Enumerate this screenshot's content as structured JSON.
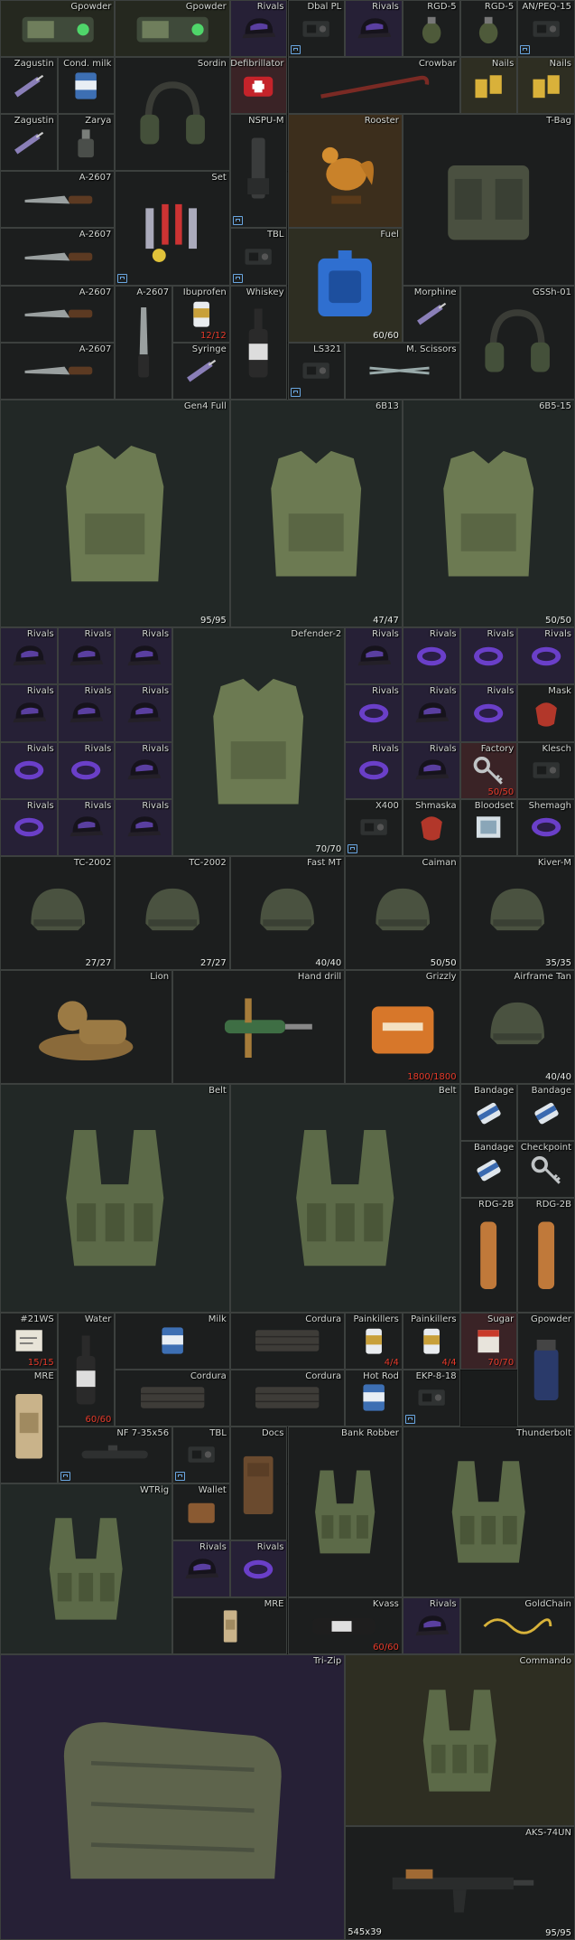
{
  "stash": {
    "footer_size": "545x39",
    "items": [
      {
        "name": "Gpowder",
        "art": "gpowder",
        "bg": "b-t",
        "c": 0,
        "r": 0,
        "w": 2,
        "h": 1
      },
      {
        "name": "Gpowder",
        "art": "gpowder",
        "bg": "b-t",
        "c": 2,
        "r": 0,
        "w": 2,
        "h": 1
      },
      {
        "name": "Rivals",
        "art": "cap",
        "bg": "b-v",
        "c": 4,
        "r": 0,
        "w": 1,
        "h": 1
      },
      {
        "name": "Dbal PL",
        "art": "device",
        "bg": "b-k",
        "c": 5,
        "r": 0,
        "w": 1,
        "h": 1,
        "tag": true
      },
      {
        "name": "Rivals",
        "art": "cap",
        "bg": "b-v",
        "c": 6,
        "r": 0,
        "w": 1,
        "h": 1
      },
      {
        "name": "RGD-5",
        "art": "grenade",
        "bg": "b-k",
        "c": 7,
        "r": 0,
        "w": 1,
        "h": 1
      },
      {
        "name": "RGD-5",
        "art": "grenade",
        "bg": "b-k",
        "c": 8,
        "r": 0,
        "w": 1,
        "h": 1
      },
      {
        "name": "AN/PEQ-15",
        "art": "device",
        "bg": "b-k",
        "c": 9,
        "r": 0,
        "w": 1,
        "h": 1,
        "tag": true
      },
      {
        "name": "Zagustin",
        "art": "syringe",
        "bg": "b-k",
        "c": 0,
        "r": 1,
        "w": 1,
        "h": 1
      },
      {
        "name": "Cond. milk",
        "art": "can",
        "bg": "b-k",
        "c": 1,
        "r": 1,
        "w": 1,
        "h": 1
      },
      {
        "name": "Sordin",
        "art": "headset",
        "bg": "b-k",
        "c": 2,
        "r": 1,
        "w": 2,
        "h": 2
      },
      {
        "name": "Defibrillator",
        "art": "defib",
        "bg": "b-r",
        "c": 4,
        "r": 1,
        "w": 1,
        "h": 1
      },
      {
        "name": "Crowbar",
        "art": "crowbar",
        "bg": "b-k",
        "c": 5,
        "r": 1,
        "w": 3,
        "h": 1
      },
      {
        "name": "Nails",
        "art": "nails",
        "bg": "b-y",
        "c": 8,
        "r": 1,
        "w": 1,
        "h": 1
      },
      {
        "name": "Nails",
        "art": "nails",
        "bg": "b-y",
        "c": 9,
        "r": 1,
        "w": 1,
        "h": 1
      },
      {
        "name": "Zagustin",
        "art": "syringe",
        "bg": "b-k",
        "c": 0,
        "r": 2,
        "w": 1,
        "h": 1
      },
      {
        "name": "Zarya",
        "art": "flashbang",
        "bg": "b-k",
        "c": 1,
        "r": 2,
        "w": 1,
        "h": 1
      },
      {
        "name": "NSPU-M",
        "art": "scope",
        "bg": "b-k",
        "c": 4,
        "r": 2,
        "w": 1,
        "h": 2,
        "tag": true
      },
      {
        "name": "Rooster",
        "art": "rooster",
        "bg": "b-o",
        "c": 5,
        "r": 2,
        "w": 2,
        "h": 2
      },
      {
        "name": "T-Bag",
        "art": "pouch",
        "bg": "b-k",
        "c": 7,
        "r": 2,
        "w": 3,
        "h": 3
      },
      {
        "name": "A-2607",
        "art": "knife",
        "bg": "b-k",
        "c": 0,
        "r": 3,
        "w": 2,
        "h": 1
      },
      {
        "name": "Set",
        "art": "toolset",
        "bg": "b-k",
        "c": 2,
        "r": 3,
        "w": 2,
        "h": 2,
        "tag": true
      },
      {
        "name": "A-2607",
        "art": "knife",
        "bg": "b-k",
        "c": 0,
        "r": 4,
        "w": 2,
        "h": 1
      },
      {
        "name": "TBL",
        "art": "device",
        "bg": "b-k",
        "c": 4,
        "r": 4,
        "w": 1,
        "h": 1,
        "tag": true
      },
      {
        "name": "Fuel",
        "art": "fuel",
        "bg": "b-y",
        "c": 5,
        "r": 4,
        "w": 2,
        "h": 2,
        "cnt": "60/60"
      },
      {
        "name": "A-2607",
        "art": "knife",
        "bg": "b-k",
        "c": 0,
        "r": 5,
        "w": 2,
        "h": 1
      },
      {
        "name": "A-2607",
        "art": "knife-v",
        "bg": "b-k",
        "c": 2,
        "r": 5,
        "w": 1,
        "h": 2
      },
      {
        "name": "Ibuprofen",
        "art": "pills",
        "bg": "b-k",
        "c": 3,
        "r": 5,
        "w": 1,
        "h": 1,
        "cnt": "12/12",
        "red": true
      },
      {
        "name": "Whiskey",
        "art": "bottle",
        "bg": "b-k",
        "c": 4,
        "r": 5,
        "w": 1,
        "h": 2
      },
      {
        "name": "Morphine",
        "art": "syringe",
        "bg": "b-k",
        "c": 7,
        "r": 5,
        "w": 1,
        "h": 1
      },
      {
        "name": "GSSh-01",
        "art": "headset",
        "bg": "b-k",
        "c": 8,
        "r": 5,
        "w": 2,
        "h": 2
      },
      {
        "name": "A-2607",
        "art": "knife",
        "bg": "b-k",
        "c": 0,
        "r": 6,
        "w": 2,
        "h": 1
      },
      {
        "name": "Syringe",
        "art": "syringe",
        "bg": "b-k",
        "c": 3,
        "r": 6,
        "w": 1,
        "h": 1
      },
      {
        "name": "LS321",
        "art": "device",
        "bg": "b-k",
        "c": 5,
        "r": 6,
        "w": 1,
        "h": 1,
        "tag": true
      },
      {
        "name": "M. Scissors",
        "art": "scissors",
        "bg": "b-k",
        "c": 6,
        "r": 6,
        "w": 2,
        "h": 1
      },
      {
        "name": "Gen4 Full",
        "art": "armor",
        "bg": "b-g",
        "c": 0,
        "r": 7,
        "w": 4,
        "h": 4,
        "cnt": "95/95"
      },
      {
        "name": "6B13",
        "art": "armor",
        "bg": "b-g",
        "c": 4,
        "r": 7,
        "w": 3,
        "h": 4,
        "cnt": "47/47"
      },
      {
        "name": "6B5-15",
        "art": "armor",
        "bg": "b-g",
        "c": 7,
        "r": 7,
        "w": 3,
        "h": 4,
        "cnt": "50/50"
      },
      {
        "name": "Rivals",
        "art": "cap",
        "bg": "b-v",
        "c": 0,
        "r": 11,
        "w": 1,
        "h": 1
      },
      {
        "name": "Rivals",
        "art": "cap",
        "bg": "b-v",
        "c": 1,
        "r": 11,
        "w": 1,
        "h": 1
      },
      {
        "name": "Rivals",
        "art": "cap",
        "bg": "b-v",
        "c": 2,
        "r": 11,
        "w": 1,
        "h": 1
      },
      {
        "name": "Defender-2",
        "art": "armor",
        "bg": "b-g",
        "c": 3,
        "r": 11,
        "w": 3,
        "h": 4,
        "cnt": "70/70"
      },
      {
        "name": "Rivals",
        "art": "cap",
        "bg": "b-v",
        "c": 6,
        "r": 11,
        "w": 1,
        "h": 1
      },
      {
        "name": "Rivals",
        "art": "band",
        "bg": "b-v",
        "c": 7,
        "r": 11,
        "w": 1,
        "h": 1
      },
      {
        "name": "Rivals",
        "art": "band",
        "bg": "b-v",
        "c": 8,
        "r": 11,
        "w": 1,
        "h": 1
      },
      {
        "name": "Rivals",
        "art": "band",
        "bg": "b-v",
        "c": 9,
        "r": 11,
        "w": 1,
        "h": 1
      },
      {
        "name": "Rivals",
        "art": "cap",
        "bg": "b-v",
        "c": 0,
        "r": 12,
        "w": 1,
        "h": 1
      },
      {
        "name": "Rivals",
        "art": "cap",
        "bg": "b-v",
        "c": 1,
        "r": 12,
        "w": 1,
        "h": 1
      },
      {
        "name": "Rivals",
        "art": "cap",
        "bg": "b-v",
        "c": 2,
        "r": 12,
        "w": 1,
        "h": 1
      },
      {
        "name": "Rivals",
        "art": "band",
        "bg": "b-v",
        "c": 6,
        "r": 12,
        "w": 1,
        "h": 1
      },
      {
        "name": "Rivals",
        "art": "cap",
        "bg": "b-v",
        "c": 7,
        "r": 12,
        "w": 1,
        "h": 1
      },
      {
        "name": "Rivals",
        "art": "band",
        "bg": "b-v",
        "c": 8,
        "r": 12,
        "w": 1,
        "h": 1
      },
      {
        "name": "Mask",
        "art": "mask",
        "bg": "b-k",
        "c": 9,
        "r": 12,
        "w": 1,
        "h": 1
      },
      {
        "name": "Rivals",
        "art": "band",
        "bg": "b-v",
        "c": 0,
        "r": 13,
        "w": 1,
        "h": 1
      },
      {
        "name": "Rivals",
        "art": "band",
        "bg": "b-v",
        "c": 1,
        "r": 13,
        "w": 1,
        "h": 1
      },
      {
        "name": "Rivals",
        "art": "cap",
        "bg": "b-v",
        "c": 2,
        "r": 13,
        "w": 1,
        "h": 1
      },
      {
        "name": "Rivals",
        "art": "band",
        "bg": "b-v",
        "c": 6,
        "r": 13,
        "w": 1,
        "h": 1
      },
      {
        "name": "Rivals",
        "art": "cap",
        "bg": "b-v",
        "c": 7,
        "r": 13,
        "w": 1,
        "h": 1
      },
      {
        "name": "Factory",
        "art": "key",
        "bg": "b-r",
        "c": 8,
        "r": 13,
        "w": 1,
        "h": 1,
        "cnt": "50/50",
        "red": true
      },
      {
        "name": "Klesch",
        "art": "device",
        "bg": "b-k",
        "c": 9,
        "r": 13,
        "w": 1,
        "h": 1
      },
      {
        "name": "Rivals",
        "art": "band",
        "bg": "b-v",
        "c": 0,
        "r": 14,
        "w": 1,
        "h": 1
      },
      {
        "name": "Rivals",
        "art": "cap",
        "bg": "b-v",
        "c": 1,
        "r": 14,
        "w": 1,
        "h": 1
      },
      {
        "name": "Rivals",
        "art": "cap",
        "bg": "b-v",
        "c": 2,
        "r": 14,
        "w": 1,
        "h": 1
      },
      {
        "name": "X400",
        "art": "device",
        "bg": "b-k",
        "c": 6,
        "r": 14,
        "w": 1,
        "h": 1,
        "tag": true
      },
      {
        "name": "Shmaska",
        "art": "mask",
        "bg": "b-k",
        "c": 7,
        "r": 14,
        "w": 1,
        "h": 1
      },
      {
        "name": "Bloodset",
        "art": "bloodset",
        "bg": "b-k",
        "c": 8,
        "r": 14,
        "w": 1,
        "h": 1
      },
      {
        "name": "Shemagh",
        "art": "band",
        "bg": "b-k",
        "c": 9,
        "r": 14,
        "w": 1,
        "h": 1
      },
      {
        "name": "TC-2002",
        "art": "helmet",
        "bg": "b-k",
        "c": 0,
        "r": 15,
        "w": 2,
        "h": 2,
        "cnt": "27/27"
      },
      {
        "name": "TC-2002",
        "art": "helmet",
        "bg": "b-k",
        "c": 2,
        "r": 15,
        "w": 2,
        "h": 2,
        "cnt": "27/27"
      },
      {
        "name": "Fast MT",
        "art": "helmet",
        "bg": "b-k",
        "c": 4,
        "r": 15,
        "w": 2,
        "h": 2,
        "cnt": "40/40"
      },
      {
        "name": "Caiman",
        "art": "helmet",
        "bg": "b-k",
        "c": 6,
        "r": 15,
        "w": 2,
        "h": 2,
        "cnt": "50/50"
      },
      {
        "name": "Kiver-M",
        "art": "helmet",
        "bg": "b-k",
        "c": 8,
        "r": 15,
        "w": 2,
        "h": 2,
        "cnt": "35/35"
      },
      {
        "name": "Lion",
        "art": "lion",
        "bg": "b-k",
        "c": 0,
        "r": 17,
        "w": 3,
        "h": 2
      },
      {
        "name": "Hand drill",
        "art": "drill",
        "bg": "b-k",
        "c": 3,
        "r": 17,
        "w": 3,
        "h": 2
      },
      {
        "name": "Grizzly",
        "art": "medkit",
        "bg": "b-k",
        "c": 6,
        "r": 17,
        "w": 2,
        "h": 2,
        "cnt": "1800/1800",
        "red": true
      },
      {
        "name": "Airframe Tan",
        "art": "helmet",
        "bg": "b-k",
        "c": 8,
        "r": 17,
        "w": 2,
        "h": 2,
        "cnt": "40/40"
      },
      {
        "name": "Belt",
        "art": "rig",
        "bg": "b-g",
        "c": 0,
        "r": 19,
        "w": 4,
        "h": 4
      },
      {
        "name": "Belt",
        "art": "rig",
        "bg": "b-g",
        "c": 4,
        "r": 19,
        "w": 4,
        "h": 4
      },
      {
        "name": "Bandage",
        "art": "bandage",
        "bg": "b-k",
        "c": 8,
        "r": 19,
        "w": 1,
        "h": 1
      },
      {
        "name": "Bandage",
        "art": "bandage",
        "bg": "b-k",
        "c": 9,
        "r": 19,
        "w": 1,
        "h": 1
      },
      {
        "name": "Bandage",
        "art": "bandage",
        "bg": "b-k",
        "c": 8,
        "r": 20,
        "w": 1,
        "h": 1
      },
      {
        "name": "Checkpoint",
        "art": "key",
        "bg": "b-k",
        "c": 9,
        "r": 20,
        "w": 1,
        "h": 1
      },
      {
        "name": "RDG-2B",
        "art": "tube",
        "bg": "b-k",
        "c": 8,
        "r": 21,
        "w": 1,
        "h": 2
      },
      {
        "name": "RDG-2B",
        "art": "tube",
        "bg": "b-k",
        "c": 9,
        "r": 21,
        "w": 1,
        "h": 2
      },
      {
        "name": "#21WS",
        "art": "note",
        "bg": "b-k",
        "c": 0,
        "r": 23,
        "w": 1,
        "h": 1,
        "cnt": "15/15",
        "red": true
      },
      {
        "name": "Water",
        "art": "bottle",
        "bg": "b-k",
        "c": 1,
        "r": 23,
        "w": 1,
        "h": 2,
        "cnt": "60/60",
        "red": true
      },
      {
        "name": "Milk",
        "art": "can",
        "bg": "b-k",
        "c": 2,
        "r": 23,
        "w": 2,
        "h": 1
      },
      {
        "name": "Cordura",
        "art": "cloth",
        "bg": "b-k",
        "c": 4,
        "r": 23,
        "w": 2,
        "h": 1
      },
      {
        "name": "Painkillers",
        "art": "pills",
        "bg": "b-k",
        "c": 6,
        "r": 23,
        "w": 1,
        "h": 1,
        "cnt": "4/4",
        "red": true
      },
      {
        "name": "Painkillers",
        "art": "pills",
        "bg": "b-k",
        "c": 7,
        "r": 23,
        "w": 1,
        "h": 1,
        "cnt": "4/4",
        "red": true
      },
      {
        "name": "Sugar",
        "art": "sugar",
        "bg": "b-r",
        "c": 8,
        "r": 23,
        "w": 1,
        "h": 1,
        "cnt": "70/70",
        "red": true
      },
      {
        "name": "Gpowder",
        "art": "jar",
        "bg": "b-k",
        "c": 9,
        "r": 23,
        "w": 1,
        "h": 2
      },
      {
        "name": "MRE",
        "art": "mre",
        "bg": "b-k",
        "c": 0,
        "r": 24,
        "w": 1,
        "h": 2
      },
      {
        "name": "Cordura",
        "art": "cloth",
        "bg": "b-k",
        "c": 2,
        "r": 24,
        "w": 2,
        "h": 1
      },
      {
        "name": "Cordura",
        "art": "cloth",
        "bg": "b-k",
        "c": 4,
        "r": 24,
        "w": 2,
        "h": 1
      },
      {
        "name": "Hot Rod",
        "art": "can",
        "bg": "b-k",
        "c": 6,
        "r": 24,
        "w": 1,
        "h": 1
      },
      {
        "name": "EKP-8-18",
        "art": "device",
        "bg": "b-k",
        "c": 7,
        "r": 24,
        "w": 1,
        "h": 1,
        "tag": true
      },
      {
        "name": "NF 7-35x56",
        "art": "rifle-scope",
        "bg": "b-k",
        "c": 1,
        "r": 25,
        "w": 2,
        "h": 1,
        "tag": true
      },
      {
        "name": "TBL",
        "art": "device",
        "bg": "b-k",
        "c": 3,
        "r": 25,
        "w": 1,
        "h": 1,
        "tag": true
      },
      {
        "name": "Docs",
        "art": "docs",
        "bg": "b-k",
        "c": 4,
        "r": 25,
        "w": 1,
        "h": 2
      },
      {
        "name": "Bank Robber",
        "art": "rig",
        "bg": "b-k",
        "c": 5,
        "r": 25,
        "w": 2,
        "h": 3
      },
      {
        "name": "Thunderbolt",
        "art": "rig",
        "bg": "b-k",
        "c": 7,
        "r": 25,
        "w": 3,
        "h": 3
      },
      {
        "name": "WTRig",
        "art": "rig",
        "bg": "b-g",
        "c": 0,
        "r": 26,
        "w": 3,
        "h": 3
      },
      {
        "name": "Wallet",
        "art": "wallet",
        "bg": "b-k",
        "c": 3,
        "r": 26,
        "w": 1,
        "h": 1
      },
      {
        "name": "Rivals",
        "art": "cap",
        "bg": "b-v",
        "c": 3,
        "r": 27,
        "w": 1,
        "h": 1
      },
      {
        "name": "Rivals",
        "art": "band",
        "bg": "b-v",
        "c": 4,
        "r": 27,
        "w": 1,
        "h": 1
      },
      {
        "name": "MRE",
        "art": "mre",
        "bg": "b-k",
        "c": 3,
        "r": 28,
        "w": 2,
        "h": 1
      },
      {
        "name": "Kvass",
        "art": "kvass",
        "bg": "b-k",
        "c": 5,
        "r": 28,
        "w": 2,
        "h": 1,
        "cnt": "60/60",
        "red": true
      },
      {
        "name": "Rivals",
        "art": "cap",
        "bg": "b-v",
        "c": 7,
        "r": 28,
        "w": 1,
        "h": 1
      },
      {
        "name": "GoldChain",
        "art": "chain",
        "bg": "b-k",
        "c": 8,
        "r": 28,
        "w": 2,
        "h": 1
      },
      {
        "name": "Tri-Zip",
        "art": "bag",
        "bg": "b-v",
        "c": 0,
        "r": 29,
        "w": 6,
        "h": 5
      },
      {
        "name": "Commando",
        "art": "rig",
        "bg": "b-y",
        "c": 6,
        "r": 29,
        "w": 4,
        "h": 3
      },
      {
        "name": "AKS-74UN",
        "art": "rifle",
        "bg": "b-k",
        "c": 6,
        "r": 32,
        "w": 4,
        "h": 2,
        "cnt": "95/95"
      }
    ]
  }
}
